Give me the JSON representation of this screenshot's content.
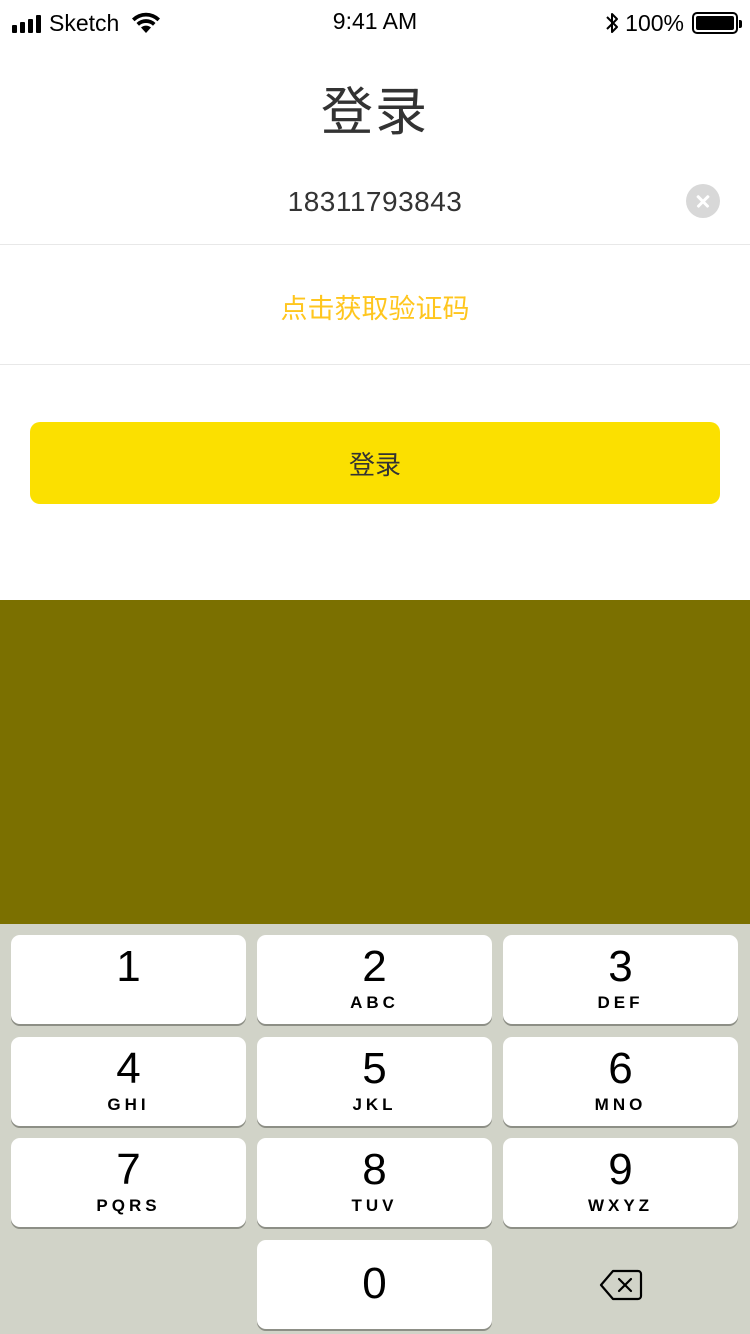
{
  "status_bar": {
    "carrier": "Sketch",
    "time": "9:41 AM",
    "battery": "100%"
  },
  "page": {
    "title": "登录"
  },
  "form": {
    "phone_value": "18311793843",
    "get_code_label": "点击获取验证码",
    "login_label": "登录"
  },
  "keypad": {
    "keys": [
      {
        "num": "1",
        "letters": ""
      },
      {
        "num": "2",
        "letters": "ABC"
      },
      {
        "num": "3",
        "letters": "DEF"
      },
      {
        "num": "4",
        "letters": "GHI"
      },
      {
        "num": "5",
        "letters": "JKL"
      },
      {
        "num": "6",
        "letters": "MNO"
      },
      {
        "num": "7",
        "letters": "PQRS"
      },
      {
        "num": "8",
        "letters": "TUV"
      },
      {
        "num": "9",
        "letters": "WXYZ"
      },
      {
        "num": "0",
        "letters": ""
      }
    ],
    "delete_icon": "backspace-icon"
  },
  "colors": {
    "accent_yellow": "#fbe000",
    "link_yellow": "#ffc61e",
    "overlay": "#7b7000",
    "keypad_bg": "#d1d3c8"
  }
}
